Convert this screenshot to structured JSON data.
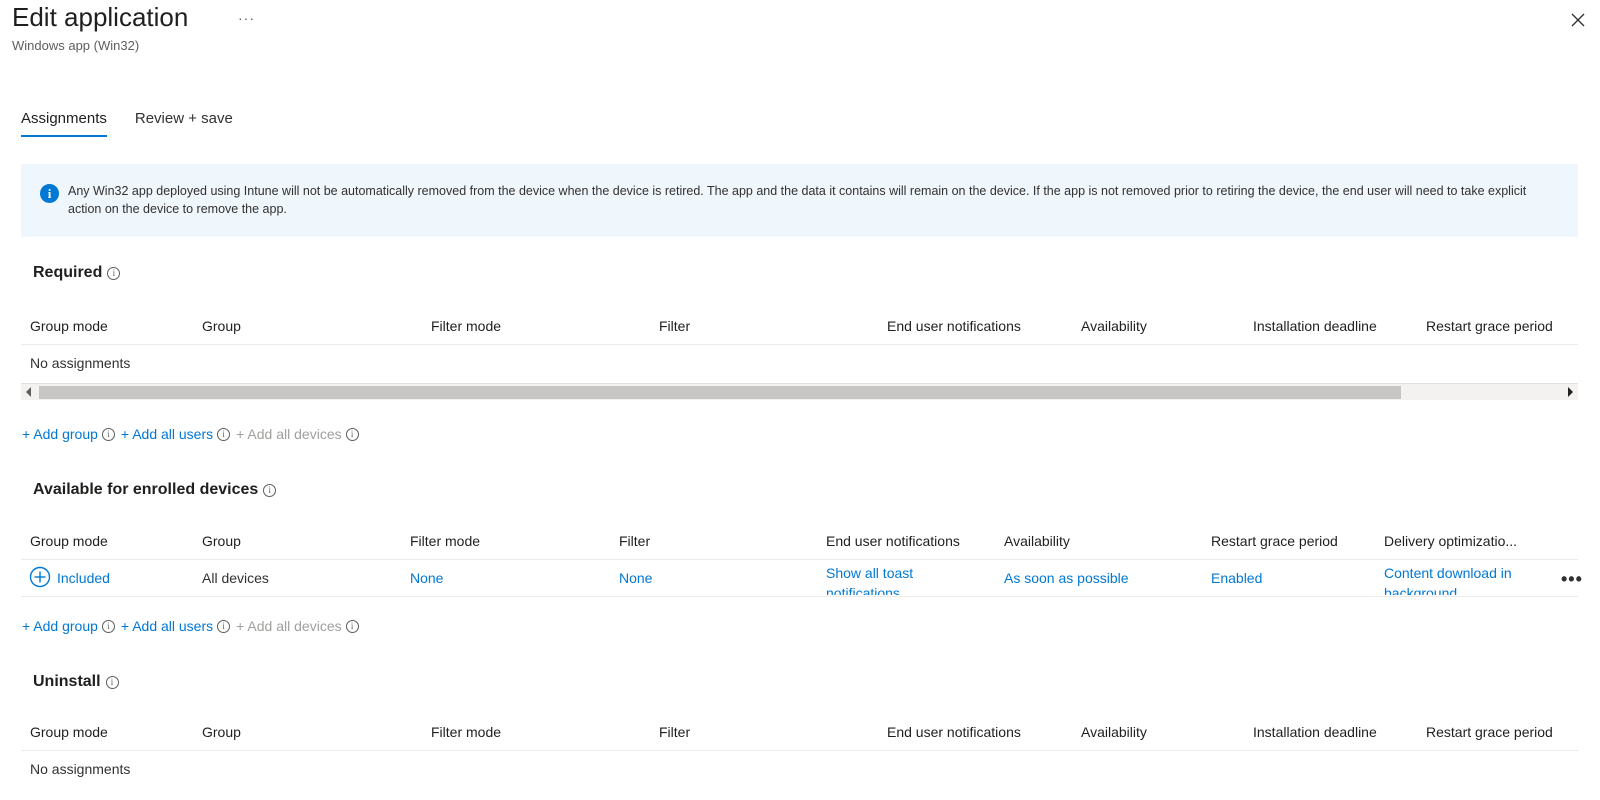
{
  "header": {
    "title": "Edit application",
    "more": "···",
    "subtitle": "Windows app (Win32)"
  },
  "tabs": [
    {
      "label": "Assignments",
      "active": true
    },
    {
      "label": "Review + save",
      "active": false
    }
  ],
  "info_banner": {
    "icon": "info-icon",
    "text": "Any Win32 app deployed using Intune will not be automatically removed from the device when the device is retired. The app and the data it contains will remain on the device. If the app is not removed prior to retiring the device, the end user will need to take explicit action on the device to remove the app."
  },
  "add_links": {
    "add_group": "+ Add group",
    "add_all_users": "+ Add all users",
    "add_all_devices": "+ Add all devices"
  },
  "required": {
    "title": "Required",
    "columns": [
      "Group mode",
      "Group",
      "Filter mode",
      "Filter",
      "End user notifications",
      "Availability",
      "Installation deadline",
      "Restart grace period"
    ],
    "empty_text": "No assignments"
  },
  "available": {
    "title": "Available for enrolled devices",
    "columns": [
      "Group mode",
      "Group",
      "Filter mode",
      "Filter",
      "End user notifications",
      "Availability",
      "Restart grace period",
      "Delivery optimizatio..."
    ],
    "rows": [
      {
        "group_mode": "Included",
        "group": "All devices",
        "filter_mode": "None",
        "filter": "None",
        "end_user_notifications": "Show all toast notifications",
        "availability": "As soon as possible",
        "restart_grace_period": "Enabled",
        "delivery_optimization": "Content download in background",
        "more": "•••"
      }
    ]
  },
  "uninstall": {
    "title": "Uninstall",
    "columns": [
      "Group mode",
      "Group",
      "Filter mode",
      "Filter",
      "End user notifications",
      "Availability",
      "Installation deadline",
      "Restart grace period"
    ],
    "empty_text": "No assignments"
  },
  "colors": {
    "accent": "#0078d4",
    "banner_bg": "#eff6fc",
    "disabled": "#a19f9d"
  }
}
